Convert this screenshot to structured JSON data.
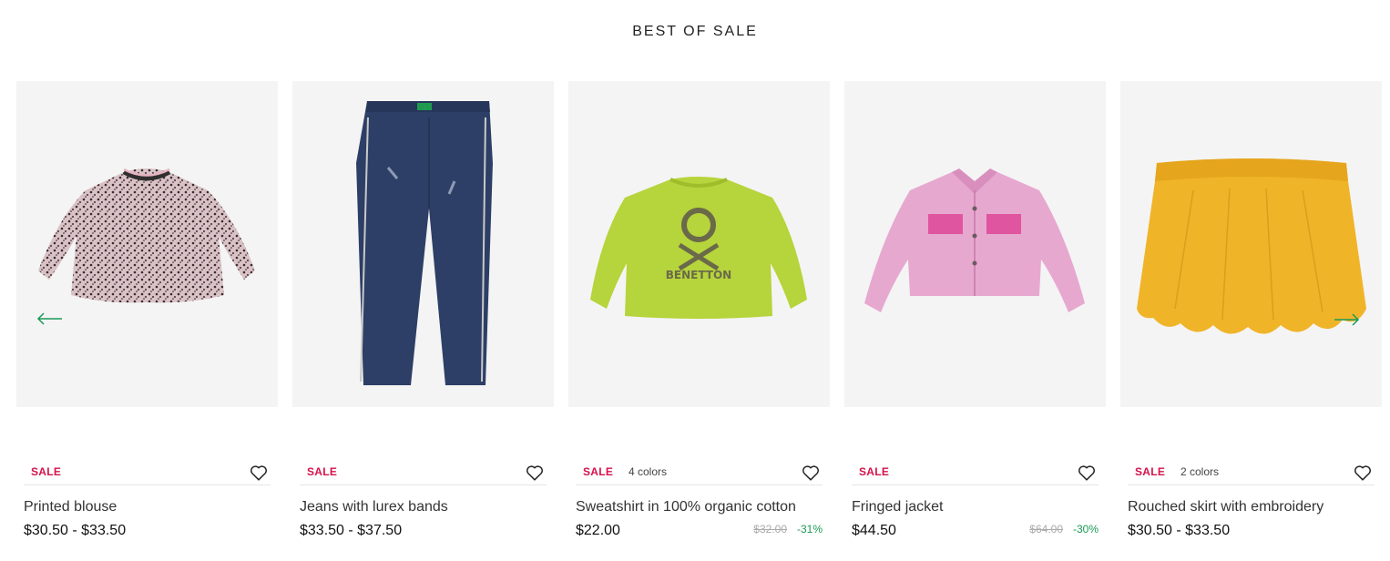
{
  "section": {
    "title": "BEST OF SALE"
  },
  "nav": {
    "prev_icon": "arrow-left-icon",
    "next_icon": "arrow-right-icon",
    "accent": "#1a9a56"
  },
  "products": [
    {
      "name": "Printed blouse",
      "badge": "SALE",
      "colors": "",
      "price": "$30.50 - $33.50",
      "old_price": "",
      "discount": ""
    },
    {
      "name": "Jeans with lurex bands",
      "badge": "SALE",
      "colors": "",
      "price": "$33.50 - $37.50",
      "old_price": "",
      "discount": ""
    },
    {
      "name": "Sweatshirt in 100% organic cotton",
      "badge": "SALE",
      "colors": "4 colors",
      "price": "$22.00",
      "old_price": "$32.00",
      "discount": "-31%"
    },
    {
      "name": "Fringed jacket",
      "badge": "SALE",
      "colors": "",
      "price": "$44.50",
      "old_price": "$64.00",
      "discount": "-30%"
    },
    {
      "name": "Rouched skirt with embroidery",
      "badge": "SALE",
      "colors": "2 colors",
      "price": "$30.50 - $33.50",
      "old_price": "",
      "discount": ""
    }
  ],
  "print": {
    "sweatshirt_logo": "BENETTON"
  },
  "colors": {
    "sale": "#d6124c",
    "discount": "#1a9a56",
    "tile_bg": "#f4f4f4"
  }
}
